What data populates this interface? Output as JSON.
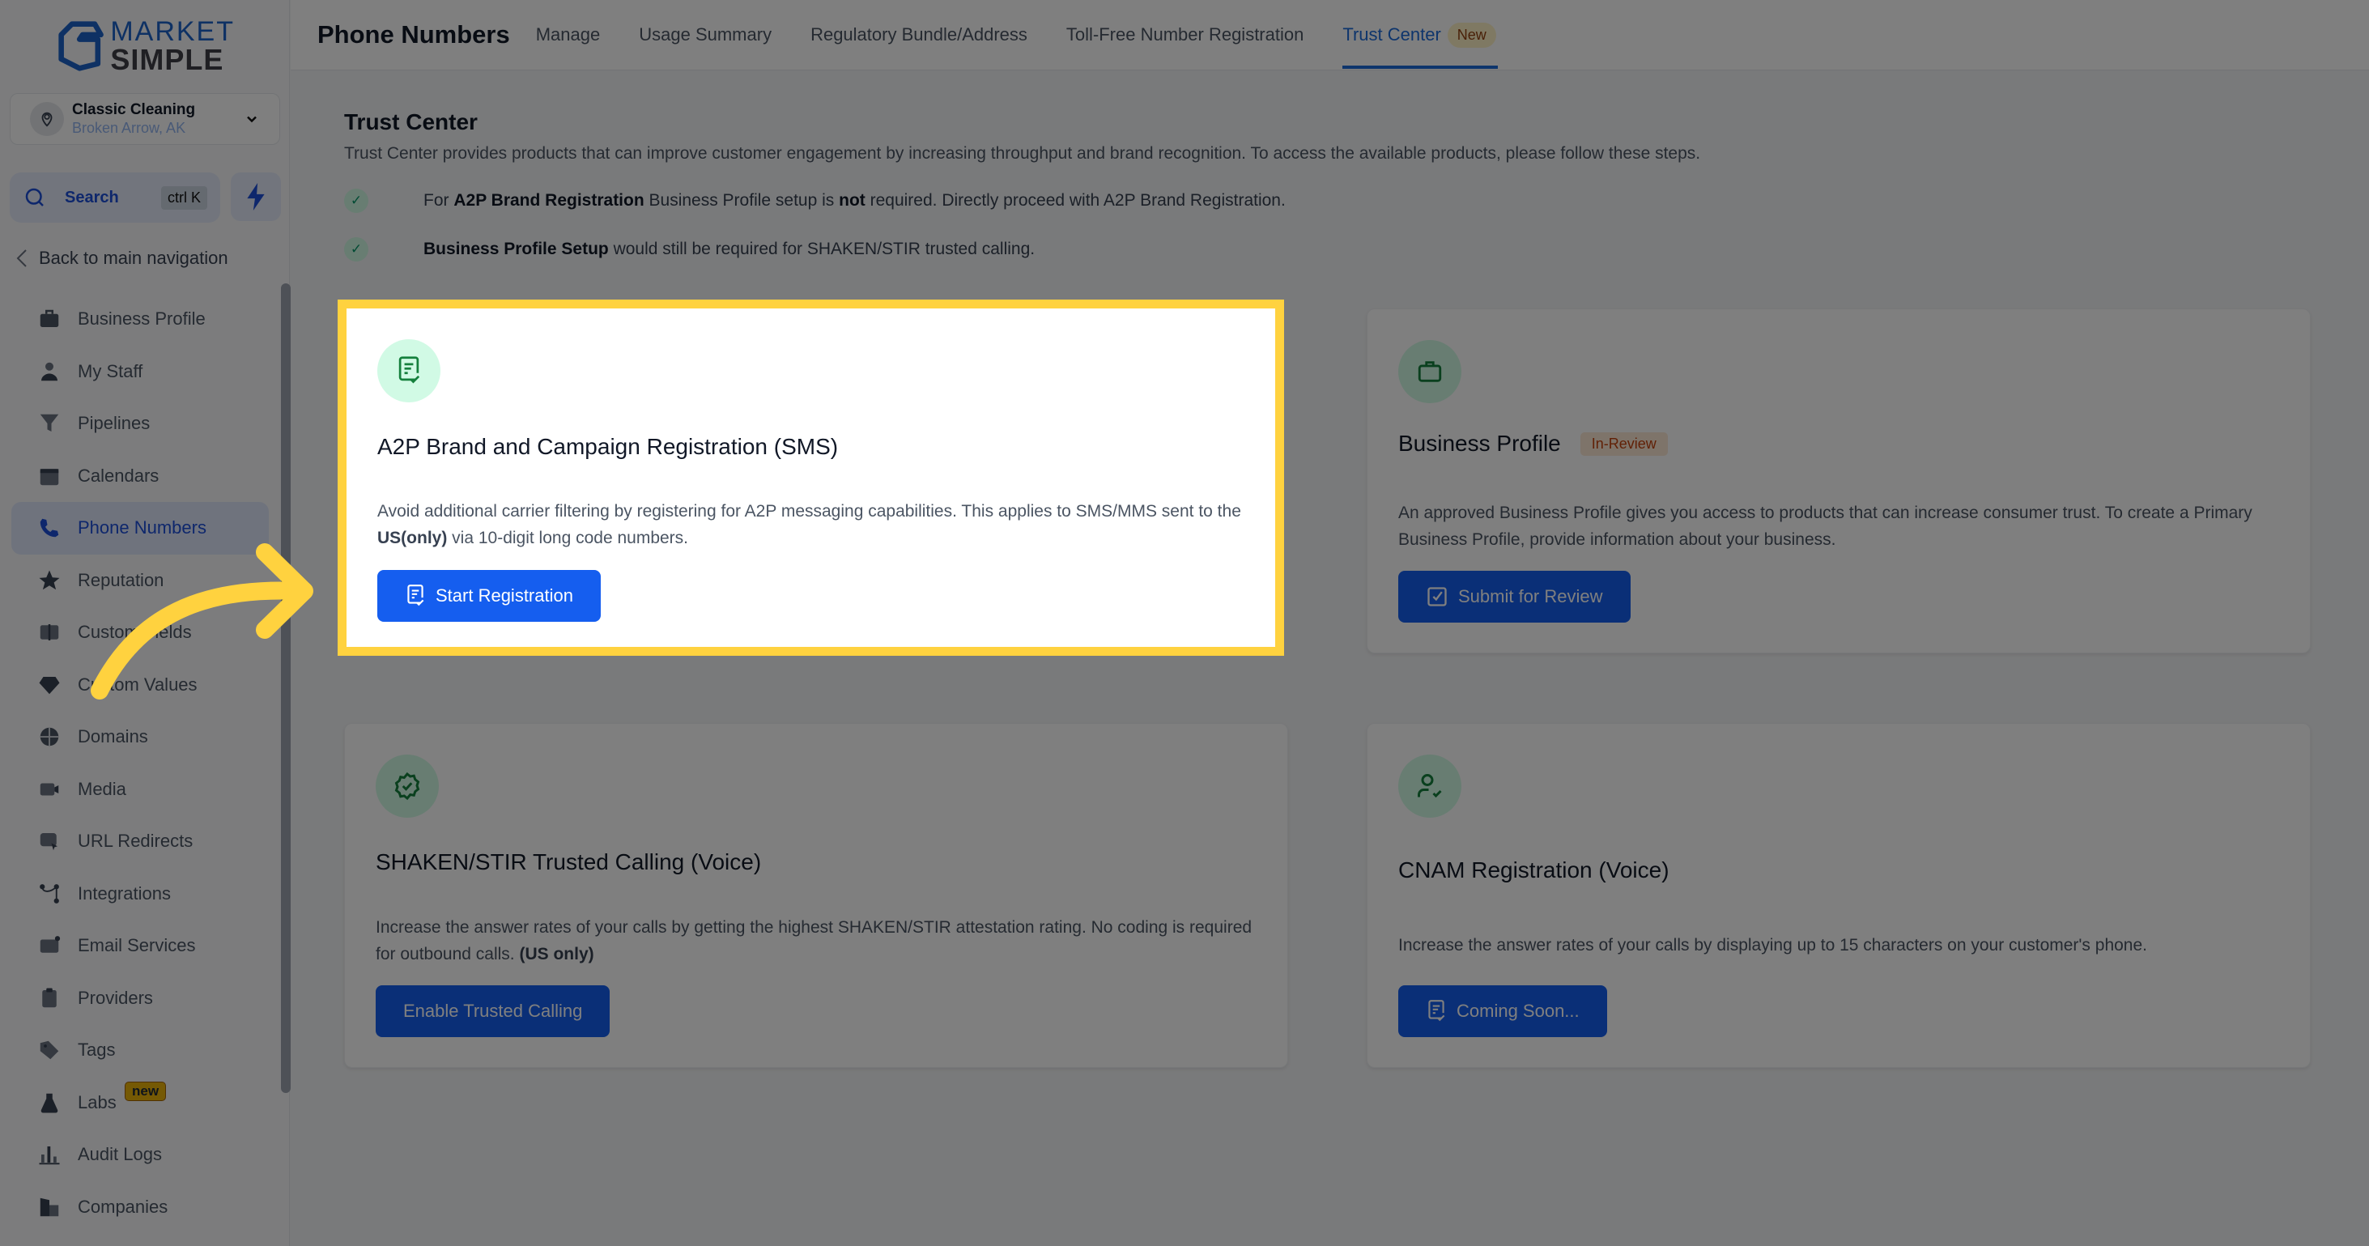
{
  "brand": {
    "line1": "MARKET",
    "line2": "SIMPLE"
  },
  "account": {
    "name": "Classic Cleaning",
    "location": "Broken Arrow, AK"
  },
  "search": {
    "label": "Search",
    "shortcut": "ctrl K"
  },
  "back_label": "Back to main navigation",
  "sidebar": {
    "items": [
      {
        "label": "Business Profile",
        "icon": "briefcase-icon"
      },
      {
        "label": "My Staff",
        "icon": "person-icon"
      },
      {
        "label": "Pipelines",
        "icon": "funnel-icon"
      },
      {
        "label": "Calendars",
        "icon": "calendar-icon"
      },
      {
        "label": "Phone Numbers",
        "icon": "phone-icon",
        "active": true
      },
      {
        "label": "Reputation",
        "icon": "star-icon"
      },
      {
        "label": "Custom Fields",
        "icon": "field-icon"
      },
      {
        "label": "Custom Values",
        "icon": "gem-icon"
      },
      {
        "label": "Domains",
        "icon": "globe-icon"
      },
      {
        "label": "Media",
        "icon": "video-icon"
      },
      {
        "label": "URL Redirects",
        "icon": "redirect-icon"
      },
      {
        "label": "Integrations",
        "icon": "integrations-icon"
      },
      {
        "label": "Email Services",
        "icon": "email-icon"
      },
      {
        "label": "Providers",
        "icon": "clipboard-check-icon"
      },
      {
        "label": "Tags",
        "icon": "tag-icon"
      },
      {
        "label": "Labs",
        "icon": "flask-icon",
        "badge": "new"
      },
      {
        "label": "Audit Logs",
        "icon": "bar-chart-icon"
      },
      {
        "label": "Companies",
        "icon": "building-icon"
      }
    ]
  },
  "header": {
    "title": "Phone Numbers",
    "tabs": [
      {
        "label": "Manage"
      },
      {
        "label": "Usage Summary"
      },
      {
        "label": "Regulatory Bundle/Address"
      },
      {
        "label": "Toll-Free Number Registration"
      },
      {
        "label": "Trust Center",
        "badge": "New",
        "active": true
      }
    ]
  },
  "trust_center": {
    "title": "Trust Center",
    "description": "Trust Center provides products that can improve customer engagement by increasing throughput and brand recognition. To access the available products, please follow these steps.",
    "steps": [
      {
        "pre": "For ",
        "b1": "A2P Brand Registration",
        "mid": " Business Profile setup is ",
        "b2": "not",
        "post": " required. Directly proceed with A2P Brand Registration."
      },
      {
        "b1": "Business Profile Setup",
        "post": " would still be required for SHAKEN/STIR trusted calling."
      }
    ]
  },
  "cards": {
    "a2p": {
      "title": "A2P Brand and Campaign Registration (SMS)",
      "desc_pre": "Avoid additional carrier filtering by registering for A2P messaging capabilities. This applies to SMS/MMS sent to the ",
      "desc_bold": "US(only)",
      "desc_post": " via 10-digit long code numbers.",
      "button": "Start Registration"
    },
    "business_profile": {
      "title": "Business Profile",
      "status": "In-Review",
      "desc": "An approved Business Profile gives you access to products that can increase consumer trust. To create a Primary Business Profile, provide information about your business.",
      "button": "Submit for Review"
    },
    "shaken": {
      "title": "SHAKEN/STIR Trusted Calling (Voice)",
      "desc_pre": "Increase the answer rates of your calls by getting the highest SHAKEN/STIR attestation rating. No coding is required for outbound calls. ",
      "desc_bold": "(US only)",
      "button": "Enable Trusted Calling"
    },
    "cnam": {
      "title": "CNAM Registration (Voice)",
      "desc": "Increase the answer rates of your calls by displaying up to 15 characters on your customer's phone.",
      "button": "Coming Soon..."
    }
  },
  "colors": {
    "accent": "#155eef",
    "highlight": "#ffd23f",
    "success": "#059669",
    "warning": "#c2410c"
  }
}
